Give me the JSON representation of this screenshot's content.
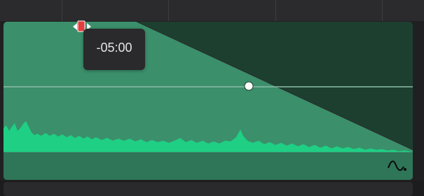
{
  "fade": {
    "tooltip_value": "-05:00"
  },
  "colors": {
    "clip_dark": "#1d3f30",
    "fade_region": "#3b8f6b",
    "waveform": "#1fcf84",
    "handle_red": "#e43d3d"
  },
  "icons": {
    "fade_handle": "fade-handle-icon",
    "curve": "curve-icon"
  }
}
